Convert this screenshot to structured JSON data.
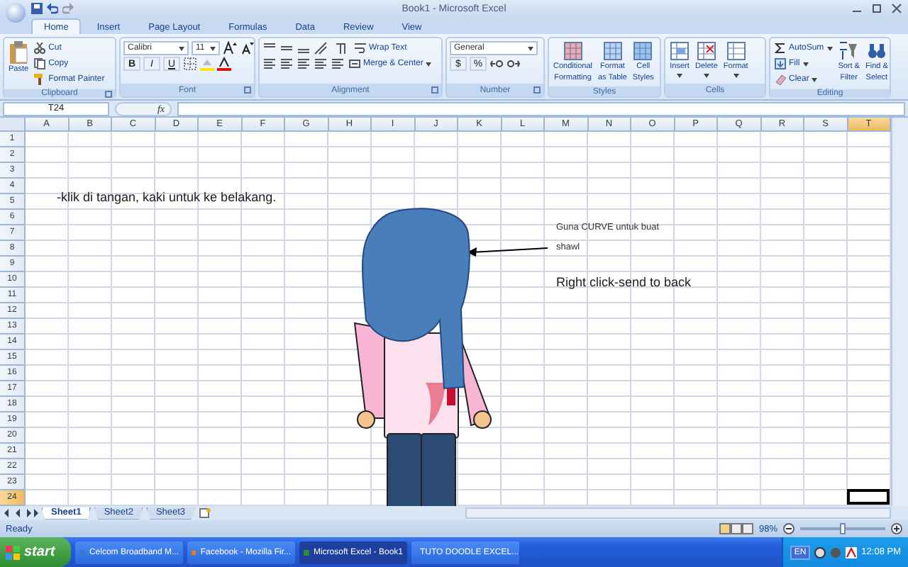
{
  "window": {
    "title": "Book1 - Microsoft Excel"
  },
  "tabs": [
    {
      "label": "Home",
      "selected": true
    },
    {
      "label": "Insert",
      "selected": false
    },
    {
      "label": "Page Layout",
      "selected": false
    },
    {
      "label": "Formulas",
      "selected": false
    },
    {
      "label": "Data",
      "selected": false
    },
    {
      "label": "Review",
      "selected": false
    },
    {
      "label": "View",
      "selected": false
    }
  ],
  "ribbon": {
    "clipboard": {
      "label": "Clipboard",
      "paste": "Paste",
      "cut": "Cut",
      "copy": "Copy",
      "format_painter": "Format Painter"
    },
    "font": {
      "label": "Font",
      "font_name": "Calibri",
      "font_size": "11",
      "styles": [
        "B",
        "I",
        "U"
      ]
    },
    "alignment": {
      "label": "Alignment",
      "wrap_text": "Wrap Text",
      "merge": "Merge & Center"
    },
    "number": {
      "label": "Number",
      "format": "General",
      "currency": "$",
      "percent": "%"
    },
    "styles": {
      "label": "Styles",
      "buttons": [
        [
          "Conditional",
          "Formatting"
        ],
        [
          "Format",
          "as Table"
        ],
        [
          "Cell",
          "Styles"
        ]
      ]
    },
    "cells": {
      "label": "Cells",
      "buttons": [
        "Insert",
        "Delete",
        "Format"
      ]
    },
    "editing": {
      "label": "Editing",
      "autosum": "AutoSum",
      "fill": "Fill",
      "clear": "Clear",
      "buttons": [
        [
          "Sort &",
          "Filter"
        ],
        [
          "Find &",
          "Select"
        ]
      ]
    }
  },
  "formula_bar": {
    "name_box": "T24",
    "fx": "fx"
  },
  "sheet": {
    "columns": [
      {
        "label": "A",
        "selected": false
      },
      {
        "label": "B",
        "selected": false
      },
      {
        "label": "C",
        "selected": false
      },
      {
        "label": "D",
        "selected": false
      },
      {
        "label": "E",
        "selected": false
      },
      {
        "label": "F",
        "selected": false
      },
      {
        "label": "G",
        "selected": false
      },
      {
        "label": "H",
        "selected": false
      },
      {
        "label": "I",
        "selected": false
      },
      {
        "label": "J",
        "selected": false
      },
      {
        "label": "K",
        "selected": false
      },
      {
        "label": "L",
        "selected": false
      },
      {
        "label": "M",
        "selected": false
      },
      {
        "label": "N",
        "selected": false
      },
      {
        "label": "O",
        "selected": false
      },
      {
        "label": "P",
        "selected": false
      },
      {
        "label": "Q",
        "selected": false
      },
      {
        "label": "R",
        "selected": false
      },
      {
        "label": "S",
        "selected": false
      },
      {
        "label": "T",
        "selected": true
      }
    ],
    "rows": [
      {
        "label": "1",
        "selected": false
      },
      {
        "label": "2",
        "selected": false
      },
      {
        "label": "3",
        "selected": false
      },
      {
        "label": "4",
        "selected": false
      },
      {
        "label": "5",
        "selected": false
      },
      {
        "label": "6",
        "selected": false
      },
      {
        "label": "7",
        "selected": false
      },
      {
        "label": "8",
        "selected": false
      },
      {
        "label": "9",
        "selected": false
      },
      {
        "label": "10",
        "selected": false
      },
      {
        "label": "11",
        "selected": false
      },
      {
        "label": "12",
        "selected": false
      },
      {
        "label": "13",
        "selected": false
      },
      {
        "label": "14",
        "selected": false
      },
      {
        "label": "15",
        "selected": false
      },
      {
        "label": "16",
        "selected": false
      },
      {
        "label": "17",
        "selected": false
      },
      {
        "label": "18",
        "selected": false
      },
      {
        "label": "19",
        "selected": false
      },
      {
        "label": "20",
        "selected": false
      },
      {
        "label": "21",
        "selected": false
      },
      {
        "label": "22",
        "selected": false
      },
      {
        "label": "23",
        "selected": false
      },
      {
        "label": "24",
        "selected": true
      }
    ],
    "notes": [
      {
        "kind": "large",
        "text": "-klik di tangan, kaki untuk ke belakang."
      },
      {
        "kind": "small",
        "text": "Guna CURVE untuk buat"
      },
      {
        "kind": "small",
        "text": "shawl"
      },
      {
        "kind": "large",
        "text": "Right click-send to back"
      }
    ]
  },
  "sheet_tabs": [
    {
      "label": "Sheet1",
      "selected": true
    },
    {
      "label": "Sheet2",
      "selected": false
    },
    {
      "label": "Sheet3",
      "selected": false
    }
  ],
  "status_bar": {
    "status": "Ready",
    "zoom": "98%",
    "zoom_level": {
      "level": 0.5
    }
  },
  "taskbar": {
    "start": "start",
    "items": [
      {
        "label": "Celcom Broadband M...",
        "selected": false
      },
      {
        "label": "Facebook - Mozilla Fir...",
        "selected": false
      },
      {
        "label": "Microsoft Excel - Book1",
        "selected": true
      },
      {
        "label": "TUTO DOODLE EXCEL...",
        "selected": false
      }
    ],
    "language": "EN",
    "clock": "12:08 PM"
  }
}
